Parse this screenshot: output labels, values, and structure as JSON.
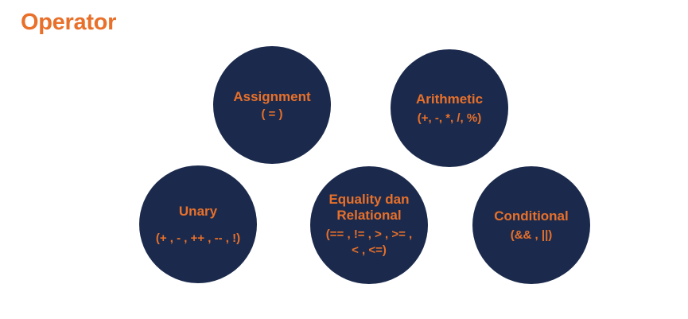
{
  "title": "Operator",
  "operators": [
    {
      "name": "Assignment",
      "ops": "( = )"
    },
    {
      "name": "Arithmetic",
      "ops": "(+, -, *, /, %)"
    },
    {
      "name": "Unary",
      "ops": "(+ , - , ++ , -- , !)"
    },
    {
      "name_line1": "Equality dan",
      "name_line2": "Relational",
      "ops_line1": "(== , != , > , >= ,",
      "ops_line2": "< , <=)"
    },
    {
      "name": "Conditional",
      "ops": "(&& , ||)"
    }
  ],
  "colors": {
    "accent": "#e8702a",
    "circle": "#1b2a4c",
    "background": "#ffffff"
  }
}
